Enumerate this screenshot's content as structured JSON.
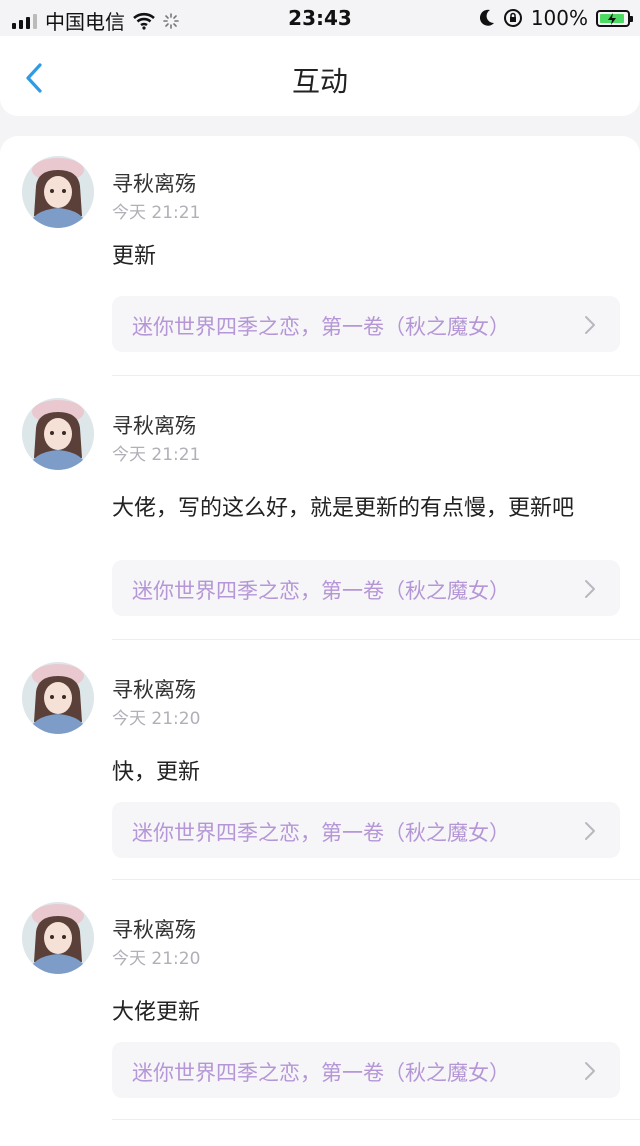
{
  "status_bar": {
    "carrier": "中国电信",
    "time": "23:43",
    "battery": "100%"
  },
  "nav": {
    "title": "互动"
  },
  "comments": [
    {
      "username": "寻秋离殇",
      "time": "今天 21:21",
      "message": "更新",
      "book": "迷你世界四季之恋，第一卷（秋之魔女）"
    },
    {
      "username": "寻秋离殇",
      "time": "今天 21:21",
      "message": "大佬，写的这么好，就是更新的有点慢，更新吧",
      "book": "迷你世界四季之恋，第一卷（秋之魔女）"
    },
    {
      "username": "寻秋离殇",
      "time": "今天 21:20",
      "message": "快，更新",
      "book": "迷你世界四季之恋，第一卷（秋之魔女）"
    },
    {
      "username": "寻秋离殇",
      "time": "今天 21:20",
      "message": "大佬更新",
      "book": "迷你世界四季之恋，第一卷（秋之魔女）"
    }
  ],
  "colors": {
    "accent": "#2f9be6",
    "link": "#b596d6",
    "battery": "#4cd964"
  },
  "icons": {
    "back": "chevron-left-icon",
    "book_link": "chevron-right-icon",
    "wifi": "wifi-icon",
    "loading": "activity-spinner-icon",
    "moon": "moon-icon",
    "lock": "orientation-lock-icon",
    "battery": "battery-icon"
  }
}
